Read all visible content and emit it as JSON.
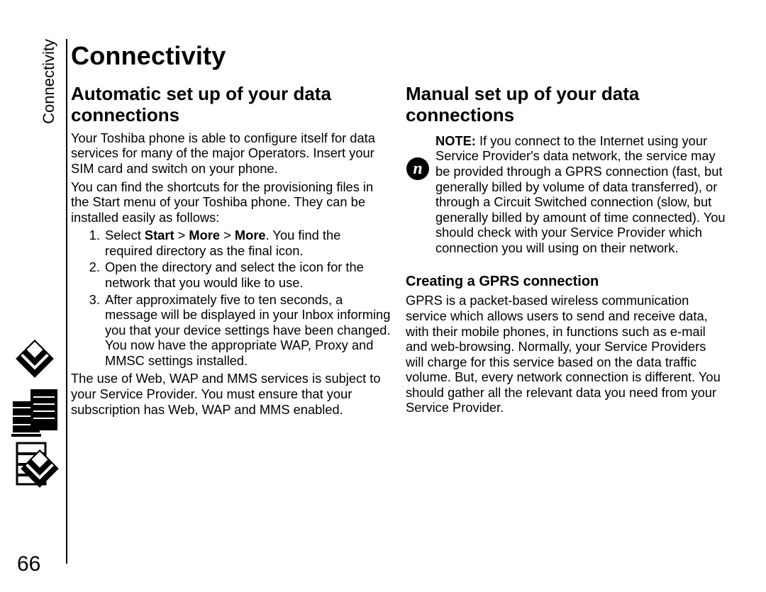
{
  "side_label": "Connectivity",
  "page_number": "66",
  "title": "Connectivity",
  "left": {
    "heading": "Automatic set up of your data connections",
    "p1": "Your Toshiba phone is able to configure itself for data services for many of the major Operators. Insert your SIM card and switch on your phone.",
    "p2": "You can find the shortcuts for the provisioning files in the Start menu of your Toshiba phone. They can be installed easily as follows:",
    "steps": {
      "s1_prefix": "Select ",
      "s1_b1": "Start",
      "s1_gt1": " > ",
      "s1_b2": "More",
      "s1_gt2": " > ",
      "s1_b3": "More",
      "s1_suffix": ". You find the required directory as the final icon.",
      "s2": "Open the directory and select the icon for the network that you would like to use.",
      "s3": "After approximately five to ten seconds, a message will be displayed in your Inbox informing you that your device settings have been changed. You now have the appropriate WAP, Proxy and MMSC settings installed."
    },
    "p3": "The use of Web, WAP and MMS services is subject to your Service Provider. You must ensure that your subscription has Web, WAP and MMS enabled."
  },
  "right": {
    "heading": "Manual set up of your data connections",
    "note_label": "NOTE:",
    "note_body": " If you connect to the Internet using your Service Provider's data network, the service may be provided through a GPRS connection (fast, but generally billed by volume of data transferred), or through a Circuit Switched connection (slow, but generally billed by amount of time connected). You should check with your Service Provider which connection you will using on their network.",
    "sub_heading": "Creating a GPRS connection",
    "sub_body": "GPRS is a packet-based wireless communication service which allows users to send and receive data, with their mobile phones, in functions such as e-mail and web-browsing. Normally, your Service Providers will charge for this service based on the data traffic volume. But, every network connection is different. You should gather all the relevant data you need from your Service Provider."
  }
}
